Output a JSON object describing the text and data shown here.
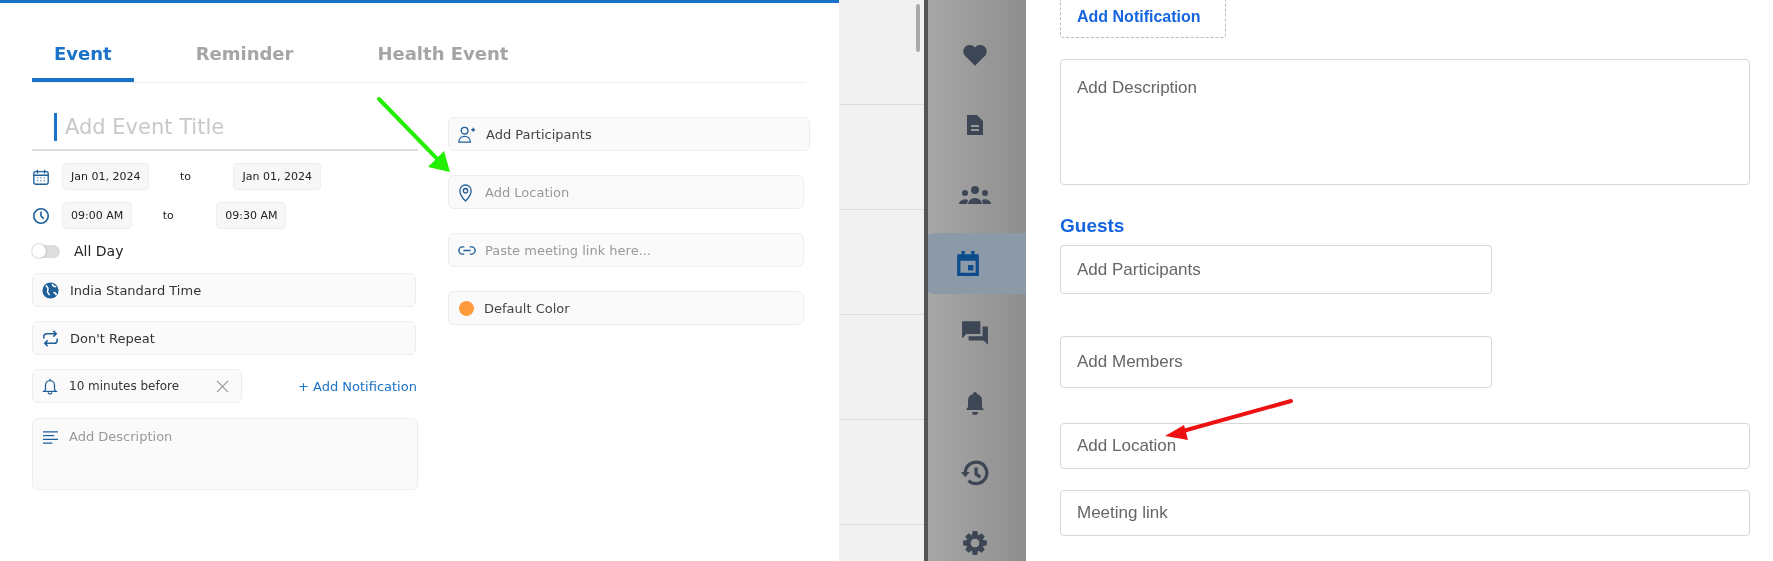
{
  "event_panel": {
    "tabs": [
      {
        "label": "Event",
        "selected": true
      },
      {
        "label": "Reminder",
        "selected": false
      },
      {
        "label": "Health Event",
        "selected": false
      }
    ],
    "title_field": {
      "placeholder": "Add Event Title"
    },
    "date_row": {
      "start": "Jan 01, 2024",
      "separator": "to",
      "end": "Jan 01, 2024"
    },
    "time_row": {
      "start": "09:00 AM",
      "separator": "to",
      "end": "09:30 AM"
    },
    "all_day": {
      "label": "All Day",
      "on": false
    },
    "timezone": "India Standard Time",
    "repeat": "Don't Repeat",
    "notification": "10 minutes before",
    "add_notification_link": "+ Add Notification",
    "description": {
      "placeholder": "Add Description"
    },
    "participants": "Add Participants",
    "location": {
      "placeholder": "Add Location"
    },
    "meeting_link": {
      "placeholder": "Paste meeting link here..."
    },
    "color": {
      "label": "Default Color",
      "color": "#ff9a3c"
    }
  },
  "sidebar": {
    "items": [
      {
        "kind": "heart",
        "selected": false
      },
      {
        "kind": "document",
        "selected": false
      },
      {
        "kind": "people",
        "selected": false
      },
      {
        "kind": "calendar",
        "selected": true
      },
      {
        "kind": "chat",
        "selected": false
      },
      {
        "kind": "bell",
        "selected": false
      },
      {
        "kind": "history",
        "selected": false
      },
      {
        "kind": "gear",
        "selected": false
      }
    ]
  },
  "right_form": {
    "add_notification": "Add Notification",
    "description": {
      "placeholder": "Add Description"
    },
    "guests_heading": "Guests",
    "participants": {
      "placeholder": "Add Participants"
    },
    "members": {
      "placeholder": "Add Members"
    },
    "location": {
      "placeholder": "Add Location"
    },
    "meeting_link": {
      "placeholder": "Meeting link"
    }
  },
  "annotations": [
    {
      "kind": "arrow",
      "color": "#22ee00"
    },
    {
      "kind": "arrow",
      "color": "#ee1111"
    }
  ]
}
